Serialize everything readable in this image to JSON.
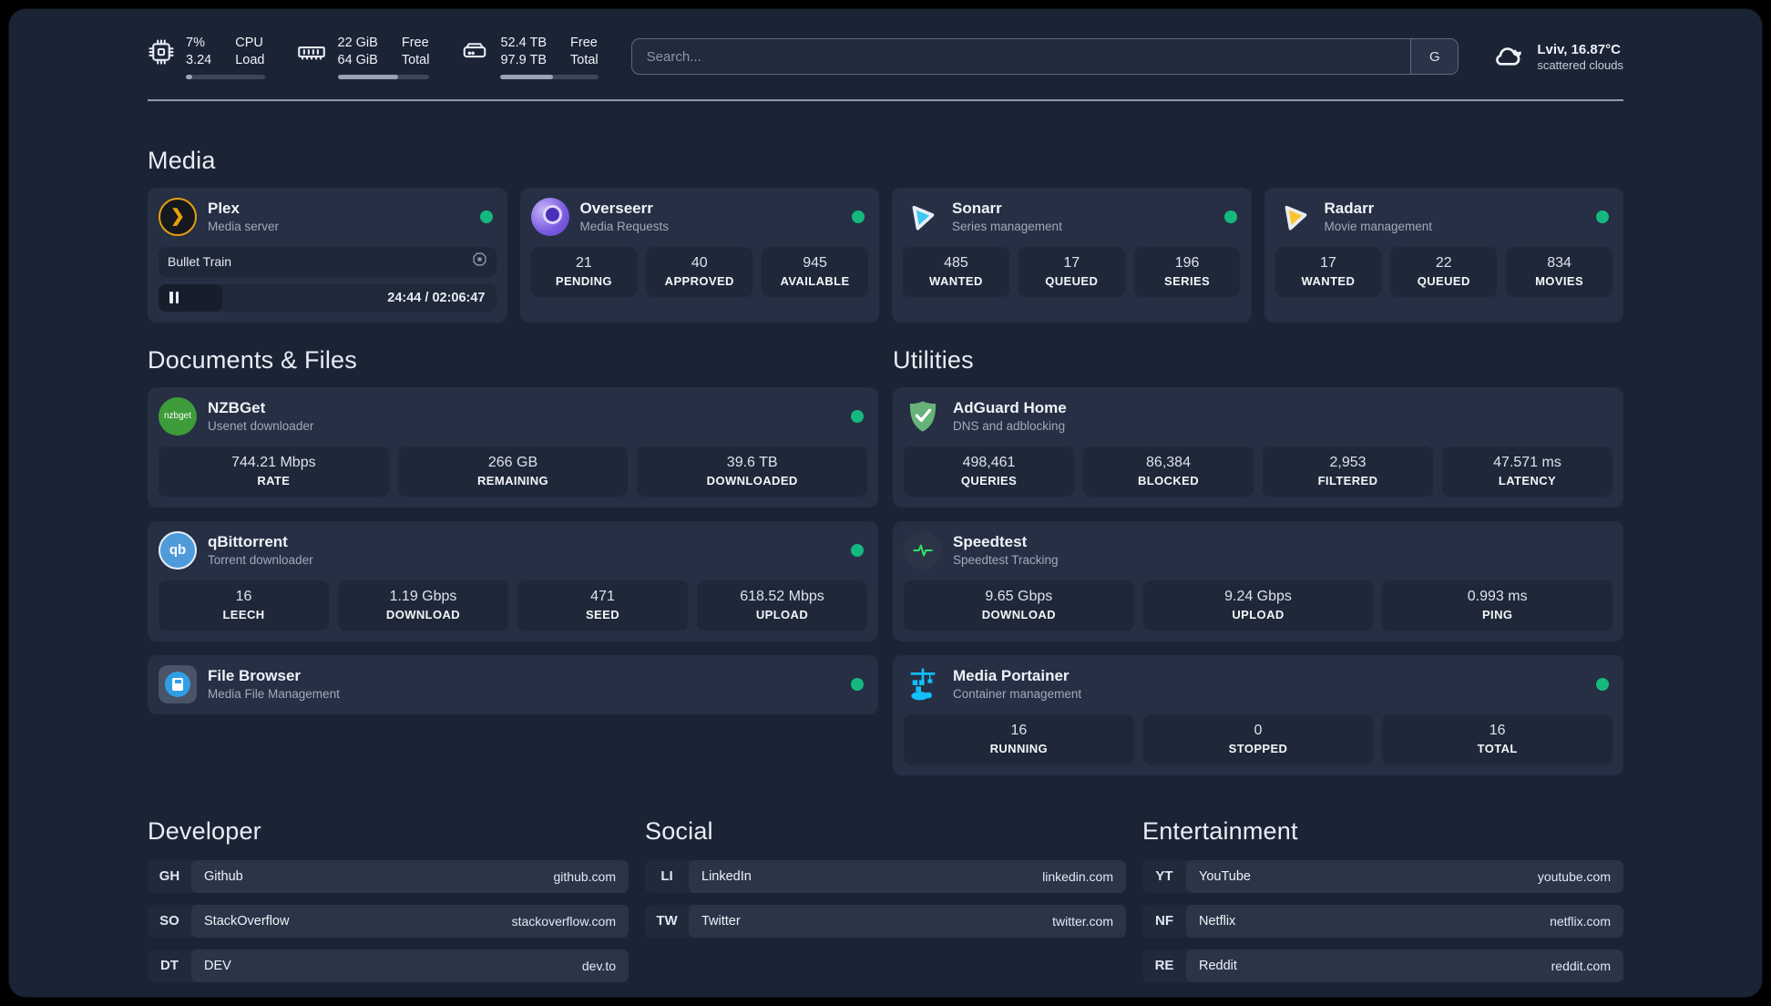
{
  "colors": {
    "status_online": "#15b87f",
    "plex_amber": "#e5a00d",
    "sonarr_blue": "#3fc6f4",
    "radarr_yellow": "#ffc230",
    "portainer_cyan": "#13bef9",
    "adguard_green": "#67b279",
    "nzbget_green": "#3e9c3a",
    "qbittorrent_blue": "#4f9bd9",
    "speedtest_pulse": "#2ee66b"
  },
  "header": {
    "metrics": [
      {
        "icon": "cpu-icon",
        "line1": "7%",
        "line2": "3.24",
        "label1": "CPU",
        "label2": "Load",
        "progress": 8
      },
      {
        "icon": "ram-icon",
        "line1": "22 GiB",
        "line2": "64 GiB",
        "label1": "Free",
        "label2": "Total",
        "progress": 66
      },
      {
        "icon": "disk-icon",
        "line1": "52.4 TB",
        "line2": "97.9 TB",
        "label1": "Free",
        "label2": "Total",
        "progress": 54
      }
    ],
    "search": {
      "placeholder": "Search...",
      "provider_button": "G"
    },
    "weather": {
      "location": "Lviv, 16.87°C",
      "condition": "scattered clouds"
    }
  },
  "media": {
    "title": "Media",
    "plex": {
      "name": "Plex",
      "subtitle": "Media server",
      "now_playing": "Bullet Train",
      "time": "24:44 / 02:06:47",
      "progress": 19
    },
    "apps": [
      {
        "name": "Overseerr",
        "subtitle": "Media Requests",
        "stats": [
          {
            "value": "21",
            "label": "PENDING"
          },
          {
            "value": "40",
            "label": "APPROVED"
          },
          {
            "value": "945",
            "label": "AVAILABLE"
          }
        ]
      },
      {
        "name": "Sonarr",
        "subtitle": "Series management",
        "stats": [
          {
            "value": "485",
            "label": "WANTED"
          },
          {
            "value": "17",
            "label": "QUEUED"
          },
          {
            "value": "196",
            "label": "SERIES"
          }
        ]
      },
      {
        "name": "Radarr",
        "subtitle": "Movie management",
        "stats": [
          {
            "value": "17",
            "label": "WANTED"
          },
          {
            "value": "22",
            "label": "QUEUED"
          },
          {
            "value": "834",
            "label": "MOVIES"
          }
        ]
      }
    ]
  },
  "documents": {
    "title": "Documents & Files",
    "nzbget": {
      "name": "NZBGet",
      "subtitle": "Usenet downloader",
      "icon_text": "nzbget",
      "stats": [
        {
          "value": "744.21 Mbps",
          "label": "RATE"
        },
        {
          "value": "266 GB",
          "label": "REMAINING"
        },
        {
          "value": "39.6 TB",
          "label": "DOWNLOADED"
        }
      ]
    },
    "qbittorrent": {
      "name": "qBittorrent",
      "subtitle": "Torrent downloader",
      "icon_text": "qb",
      "stats": [
        {
          "value": "16",
          "label": "LEECH"
        },
        {
          "value": "1.19 Gbps",
          "label": "DOWNLOAD"
        },
        {
          "value": "471",
          "label": "SEED"
        },
        {
          "value": "618.52 Mbps",
          "label": "UPLOAD"
        }
      ]
    },
    "filebrowser": {
      "name": "File Browser",
      "subtitle": "Media File Management"
    }
  },
  "utilities": {
    "title": "Utilities",
    "adguard": {
      "name": "AdGuard Home",
      "subtitle": "DNS and adblocking",
      "stats": [
        {
          "value": "498,461",
          "label": "QUERIES"
        },
        {
          "value": "86,384",
          "label": "BLOCKED"
        },
        {
          "value": "2,953",
          "label": "FILTERED"
        },
        {
          "value": "47.571 ms",
          "label": "LATENCY"
        }
      ]
    },
    "speedtest": {
      "name": "Speedtest",
      "subtitle": "Speedtest Tracking",
      "stats": [
        {
          "value": "9.65 Gbps",
          "label": "DOWNLOAD"
        },
        {
          "value": "9.24 Gbps",
          "label": "UPLOAD"
        },
        {
          "value": "0.993 ms",
          "label": "PING"
        }
      ]
    },
    "portainer": {
      "name": "Media Portainer",
      "subtitle": "Container management",
      "stats": [
        {
          "value": "16",
          "label": "RUNNING"
        },
        {
          "value": "0",
          "label": "STOPPED"
        },
        {
          "value": "16",
          "label": "TOTAL"
        }
      ]
    }
  },
  "links": {
    "sections": [
      {
        "title": "Developer",
        "items": [
          {
            "tag": "GH",
            "name": "Github",
            "url": "github.com"
          },
          {
            "tag": "SO",
            "name": "StackOverflow",
            "url": "stackoverflow.com"
          },
          {
            "tag": "DT",
            "name": "DEV",
            "url": "dev.to"
          }
        ]
      },
      {
        "title": "Social",
        "items": [
          {
            "tag": "LI",
            "name": "LinkedIn",
            "url": "linkedin.com"
          },
          {
            "tag": "TW",
            "name": "Twitter",
            "url": "twitter.com"
          }
        ]
      },
      {
        "title": "Entertainment",
        "items": [
          {
            "tag": "YT",
            "name": "YouTube",
            "url": "youtube.com"
          },
          {
            "tag": "NF",
            "name": "Netflix",
            "url": "netflix.com"
          },
          {
            "tag": "RE",
            "name": "Reddit",
            "url": "reddit.com"
          }
        ]
      }
    ]
  }
}
